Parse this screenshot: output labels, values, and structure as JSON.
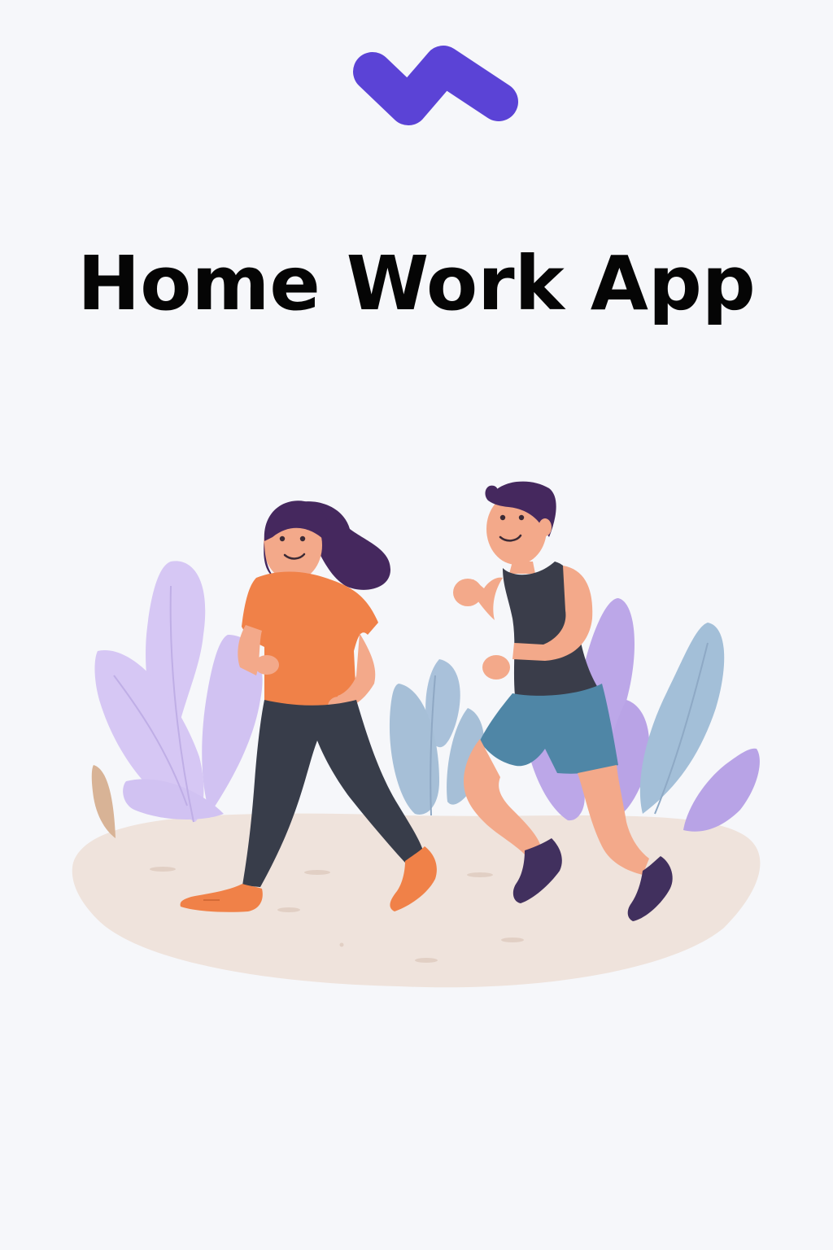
{
  "app": {
    "title": "Home Work App"
  },
  "logo": {
    "icon": "brand-wave-logo-icon",
    "color": "#5b43d6"
  },
  "illustration": {
    "icon": "joggers-illustration",
    "colors": {
      "woman_shirt": "#f08148",
      "woman_pants": "#383d4a",
      "woman_shoes": "#f08148",
      "man_tank": "#3a3d4a",
      "man_shorts": "#4f86a6",
      "man_shoes": "#41305e",
      "hair": "#45285e",
      "skin": "#f3a98a",
      "plant_lavender": "#d5c5f3",
      "plant_purple": "#b8a1e6",
      "plant_blue": "#a3bfd8",
      "ground": "#efe3dc"
    }
  }
}
